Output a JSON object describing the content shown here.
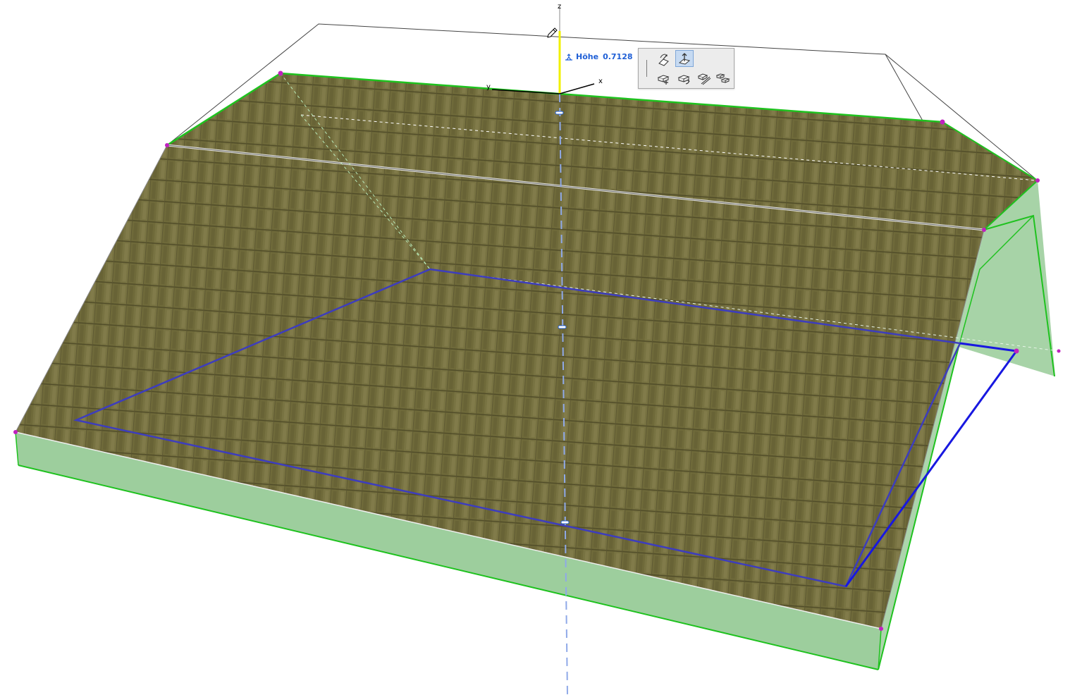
{
  "axes": {
    "x_label": "x",
    "y_label": "y",
    "z_label": "z"
  },
  "height_readout": {
    "label": "Höhe",
    "value": "0.7128"
  },
  "colors": {
    "roof_fill": "#6f6a3a",
    "tile_highlight": "#8a8452",
    "gable_fill": "#9dce9d",
    "edge_green": "#1fc21f",
    "selection_blue": "#3d3dbd",
    "blue_edge": "#1818e0",
    "z_axis": "#f0f000",
    "vertex_magenta": "#c020c0",
    "dashed_axis": "#8fa9e8",
    "ghost_outline": "#333333"
  },
  "pet_palette": {
    "buttons": [
      {
        "name": "rotate-plane-icon",
        "active": false
      },
      {
        "name": "elevate-plane-icon",
        "active": true
      },
      {
        "name": "offset-polygon-icon",
        "active": false
      },
      {
        "name": "rotate-polygon-icon",
        "active": false
      },
      {
        "name": "split-icon",
        "active": false
      },
      {
        "name": "multiply-icon",
        "active": false
      }
    ]
  }
}
